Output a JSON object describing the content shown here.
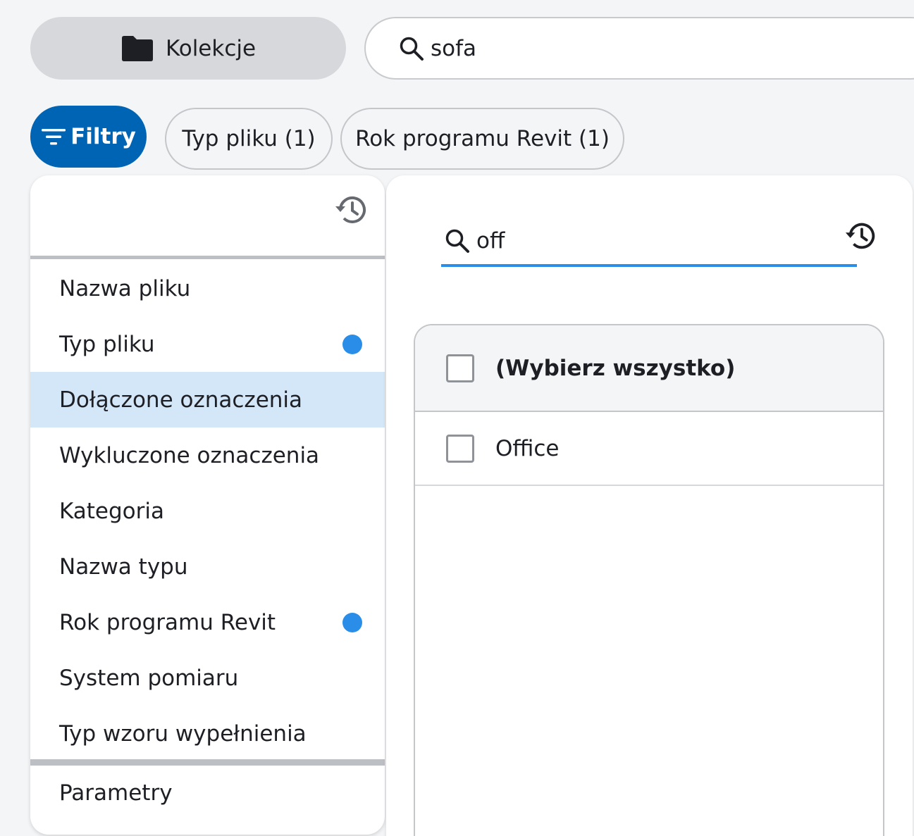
{
  "header": {
    "collections_label": "Kolekcje",
    "search_value": "sofa"
  },
  "filter_bar": {
    "filters_label": "Filtry",
    "chips": [
      {
        "label": "Typ pliku (1)"
      },
      {
        "label": "Rok programu Revit (1)"
      }
    ]
  },
  "filter_panel": {
    "items": [
      {
        "label": "Nazwa pliku",
        "active": false
      },
      {
        "label": "Typ pliku",
        "active": true
      },
      {
        "label": "Dołączone oznaczenia",
        "active": false,
        "selected": true
      },
      {
        "label": "Wykluczone oznaczenia",
        "active": false
      },
      {
        "label": "Kategoria",
        "active": false
      },
      {
        "label": "Nazwa typu",
        "active": false
      },
      {
        "label": "Rok programu Revit",
        "active": true
      },
      {
        "label": "System pomiaru",
        "active": false
      },
      {
        "label": "Typ wzoru wypełnienia",
        "active": false
      }
    ],
    "parameters_label": "Parametry"
  },
  "value_panel": {
    "search_value": "off",
    "select_all_label": "(Wybierz wszystko)",
    "values": [
      {
        "label": "Office",
        "checked": false
      }
    ]
  },
  "colors": {
    "accent": "#0064b4",
    "indicator": "#2a8ee8",
    "selected_row": "#d3e7f8"
  }
}
